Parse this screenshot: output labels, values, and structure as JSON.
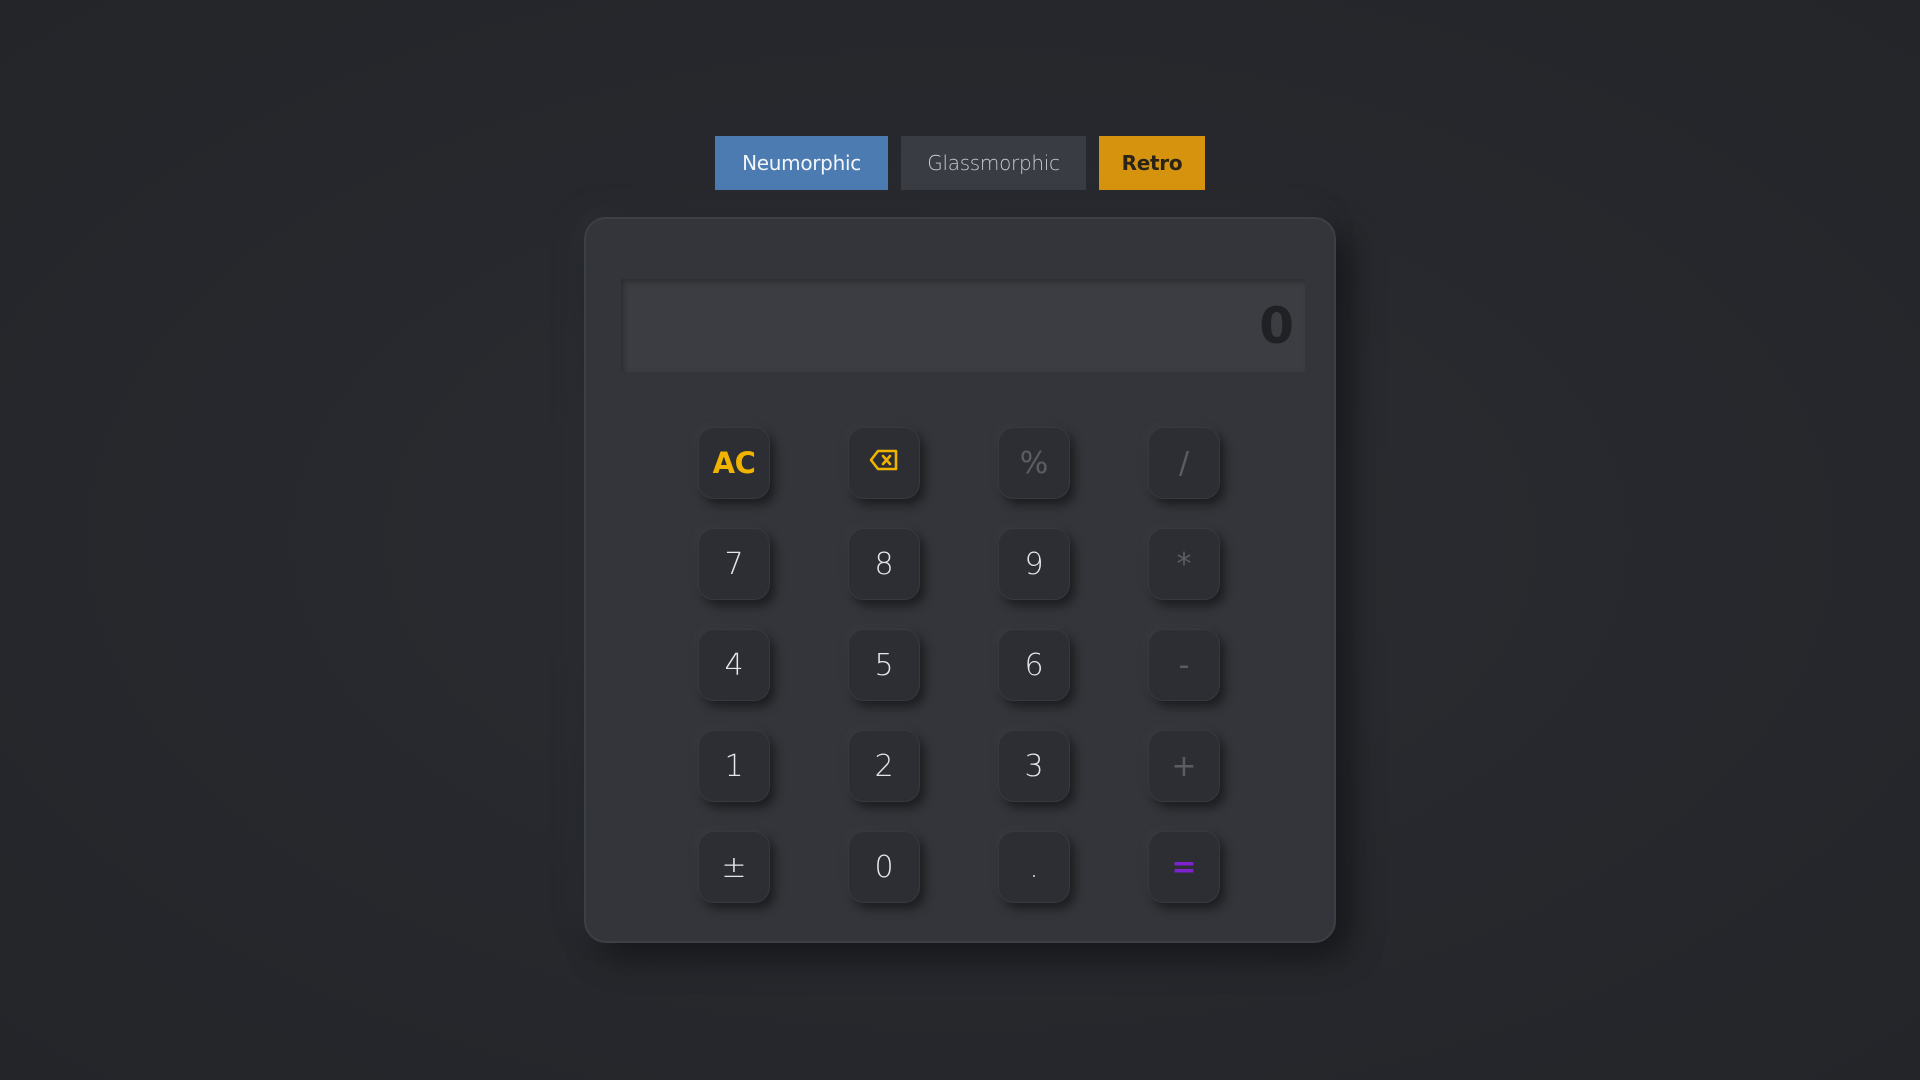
{
  "themes": {
    "neumorphic": "Neumorphic",
    "glassmorphic": "Glassmorphic",
    "retro": "Retro"
  },
  "display": {
    "value": "0"
  },
  "keys": {
    "clear": "AC",
    "backspace_icon": "backspace-icon",
    "percent": "%",
    "divide": "/",
    "seven": "7",
    "eight": "8",
    "nine": "9",
    "multiply": "*",
    "four": "4",
    "five": "5",
    "six": "6",
    "subtract": "-",
    "one": "1",
    "two": "2",
    "three": "3",
    "add": "+",
    "negate": "±",
    "zero": "0",
    "decimal": ".",
    "equals": "="
  },
  "colors": {
    "neumorphic_active": "#4b7bb1",
    "glassmorphic": "#393c43",
    "retro": "#d6940e",
    "clear_key": "#f0b400",
    "equals_key": "#7e22ce"
  }
}
